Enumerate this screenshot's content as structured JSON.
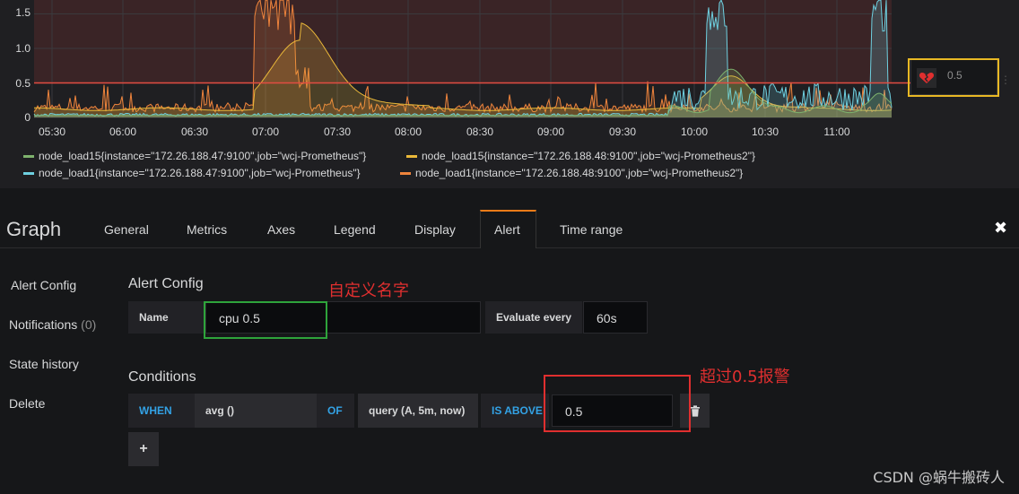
{
  "graph": {
    "y_ticks": [
      "1.5",
      "1.0",
      "0.5",
      "0"
    ],
    "x_ticks": [
      "05:30",
      "06:00",
      "06:30",
      "07:00",
      "07:30",
      "08:00",
      "08:30",
      "09:00",
      "09:30",
      "10:00",
      "10:30",
      "11:00"
    ],
    "threshold": 0.5,
    "threshold_value_text": "0.5",
    "legend": [
      {
        "label": "node_load15{instance=\"172.26.188.47:9100\",job=\"wcj-Prometheus\"}",
        "color": "#7eb26d"
      },
      {
        "label": "node_load15{instance=\"172.26.188.48:9100\",job=\"wcj-Prometheus2\"}",
        "color": "#eab839"
      },
      {
        "label": "node_load1{instance=\"172.26.188.47:9100\",job=\"wcj-Prometheus\"}",
        "color": "#6ed0e0"
      },
      {
        "label": "node_load1{instance=\"172.26.188.48:9100\",job=\"wcj-Prometheus2\"}",
        "color": "#ef843c"
      }
    ],
    "colors": {
      "threshold": "#e24d42",
      "alert_fill": "#3a2426"
    }
  },
  "editor": {
    "title": "Graph",
    "tabs": [
      "General",
      "Metrics",
      "Axes",
      "Legend",
      "Display",
      "Alert",
      "Time range"
    ],
    "active_tab": "Alert",
    "sidebar": [
      {
        "label": "Alert Config",
        "count": ""
      },
      {
        "label": "Notifications",
        "count": "(0)"
      },
      {
        "label": "State history",
        "count": ""
      },
      {
        "label": "Delete",
        "count": ""
      }
    ],
    "alert_config": {
      "title": "Alert Config",
      "name_label": "Name",
      "name_value": "cpu 0.5",
      "evaluate_label": "Evaluate every",
      "evaluate_value": "60s"
    },
    "conditions": {
      "title": "Conditions",
      "when": "WHEN",
      "reducer": "avg ()",
      "of": "OF",
      "query": "query (A, 5m, now)",
      "evaluator": "IS ABOVE",
      "value": "0.5",
      "add_label": "+"
    }
  },
  "annotations": {
    "name_note": "自定义名字",
    "threshold_note": "超过0.5报警",
    "name_box_color": "#2ea43b",
    "threshold_box_color": "#e02f2f",
    "handle_box_color": "#e8b824"
  },
  "watermark": "CSDN @蜗牛搬砖人"
}
